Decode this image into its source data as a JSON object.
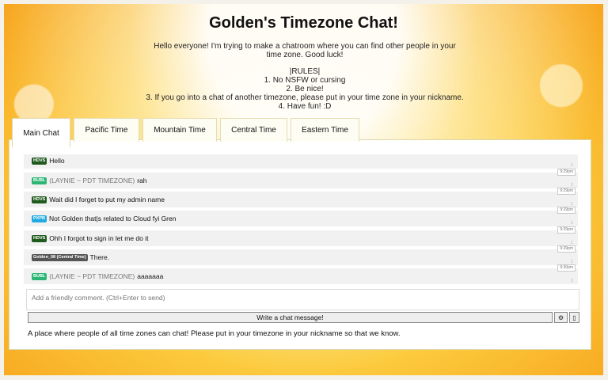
{
  "header": {
    "title": "Golden's Timezone Chat!",
    "description": "Hello everyone! I'm trying to make a chatroom where you can find other people in your time zone. Good luck!",
    "rules_heading": "|RULES|",
    "rules": [
      "1. No NSFW or cursing",
      "2. Be nice!",
      "3. If you go into a chat of another timezone, please put in your time zone in your nickname.",
      "4. Have fun! :D"
    ]
  },
  "tabs": [
    {
      "label": "Main Chat",
      "active": true
    },
    {
      "label": "Pacific Time",
      "active": false
    },
    {
      "label": "Mountain Time",
      "active": false
    },
    {
      "label": "Central Time",
      "active": false
    },
    {
      "label": "Eastern Time",
      "active": false
    }
  ],
  "messages": [
    {
      "badge": "HDVS",
      "badge_color": "#1f5a1f",
      "nick": "",
      "text": "Hello",
      "time": ""
    },
    {
      "badge": "BUBL",
      "badge_color": "#2bb673",
      "nick": "(LAYNIE ~ PDT TIMEZONE)",
      "text": "rah",
      "time": "9:29pm"
    },
    {
      "badge": "HDVS",
      "badge_color": "#1f5a1f",
      "nick": "",
      "text": "Wait did I forget to put my admin name",
      "time": "9:29pm"
    },
    {
      "badge": "PXPB",
      "badge_color": "#21a9e1",
      "nick": "",
      "text": "Not Golden that|s related to Cloud fyi Gren",
      "time": "9:29pm"
    },
    {
      "badge": "HDVS",
      "badge_color": "#1f5a1f",
      "nick": "",
      "text": "Ohh I forgot to sign in let me do it",
      "time": "9:29pm"
    },
    {
      "badge": "Golden_08 (Central Time)",
      "badge_color": "#555555",
      "nick": "",
      "text": "There.",
      "time": "9:29pm"
    },
    {
      "badge": "BUBL",
      "badge_color": "#2bb673",
      "nick": "(LAYNIE ~ PDT TIMEZONE)",
      "text": "aaaaaaa",
      "time": "9:30pm"
    }
  ],
  "composer": {
    "placeholder": "Add a friendly comment. (Ctrl+Enter to send)",
    "write_label": "Write a chat message!",
    "settings_icon": "⚙",
    "expand_icon": "▯"
  },
  "footer": {
    "text": "A place where people of all time zones can chat! Please put in your timezone in your nickname so that we know."
  }
}
